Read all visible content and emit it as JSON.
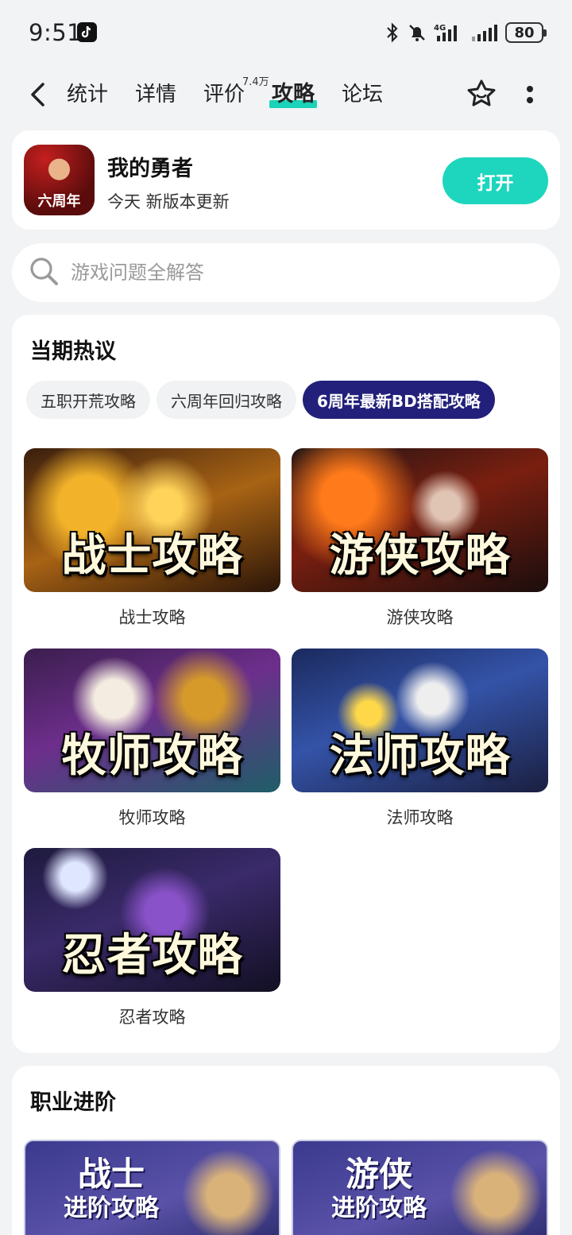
{
  "status_bar": {
    "time": "9:51",
    "battery": "80",
    "network": "4G"
  },
  "nav": {
    "tabs": [
      {
        "label": "统计"
      },
      {
        "label": "详情"
      },
      {
        "label": "评价"
      },
      {
        "label": "攻略"
      },
      {
        "label": "论坛"
      }
    ],
    "review_count_badge": "7.4万",
    "active_tab": "攻略"
  },
  "app": {
    "name": "我的勇者",
    "update_text": "今天 新版本更新",
    "icon_text": "六周年",
    "open_label": "打开"
  },
  "search": {
    "placeholder": "游戏问题全解答"
  },
  "hot": {
    "title": "当期热议",
    "chips": [
      "五职开荒攻略",
      "六周年回归攻略",
      "6周年最新BD搭配攻略"
    ],
    "active_chip": "6周年最新BD搭配攻略",
    "guides": [
      {
        "title": "战士攻略",
        "label": "战士攻略"
      },
      {
        "title": "游侠攻略",
        "label": "游侠攻略"
      },
      {
        "title": "牧师攻略",
        "label": "牧师攻略"
      },
      {
        "title": "法师攻略",
        "label": "法师攻略"
      },
      {
        "title": "忍者攻略",
        "label": "忍者攻略"
      }
    ]
  },
  "advanced": {
    "title": "职业进阶",
    "cards": [
      {
        "line1": "战士",
        "line2": "进阶攻略"
      },
      {
        "line1": "游侠",
        "line2": "进阶攻略"
      }
    ]
  },
  "colors": {
    "accent": "#1dd6bd",
    "chip_active": "#22207a"
  }
}
